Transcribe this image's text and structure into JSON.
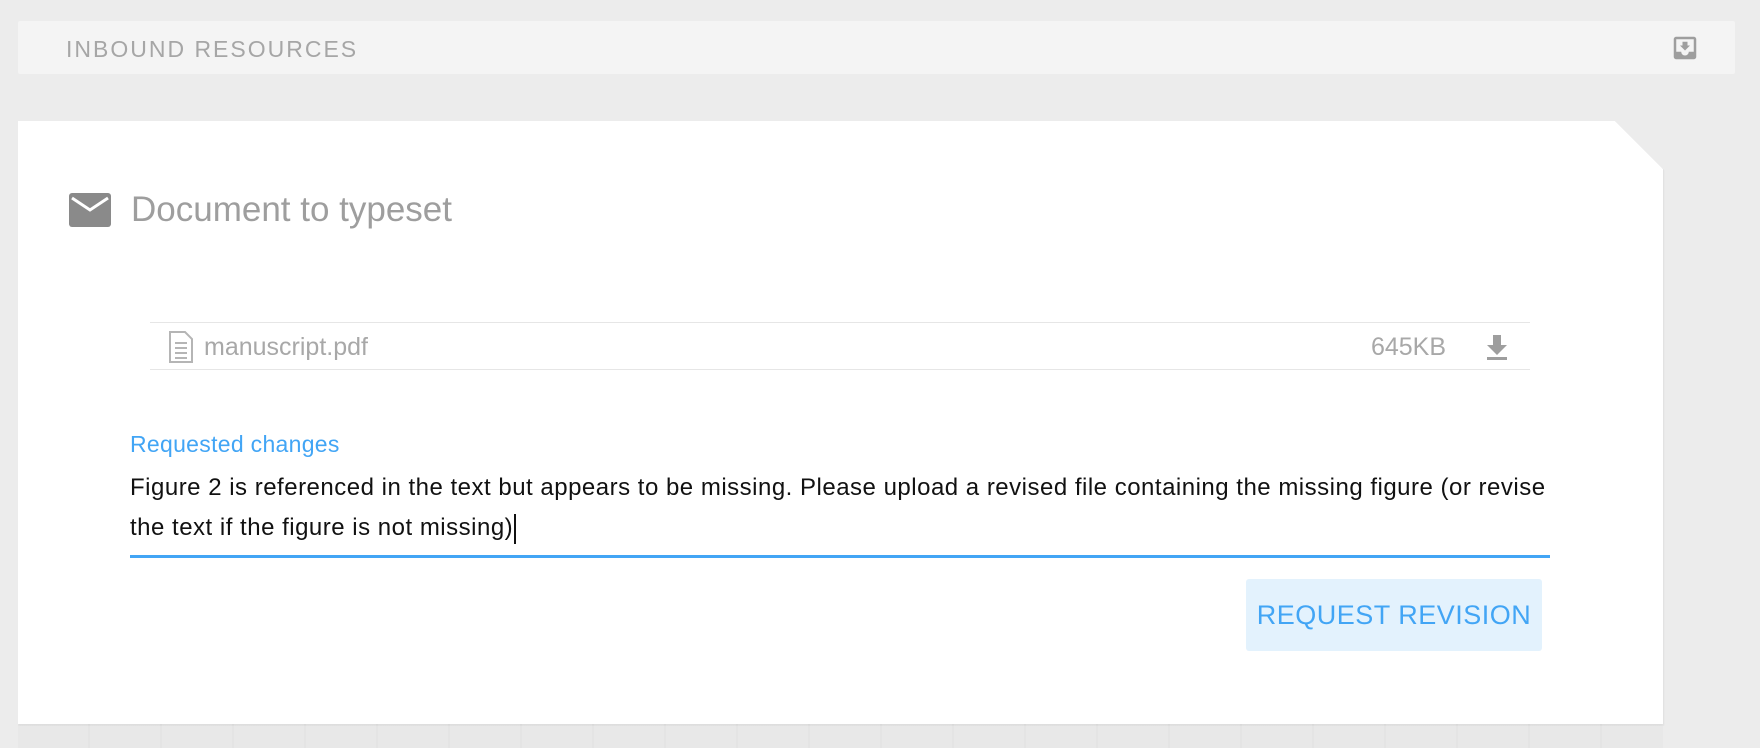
{
  "inbound": {
    "title": "INBOUND RESOURCES",
    "icon": "download-tray-icon"
  },
  "card": {
    "icon": "mail-icon",
    "title": "Document to typeset",
    "file": {
      "name": "manuscript.pdf",
      "size": "645KB",
      "file_icon": "document-icon",
      "download_icon": "download-icon"
    },
    "requested_changes": {
      "label": "Requested changes",
      "value": "Figure 2 is referenced in the text but appears to be missing. Please upload a revised file containing the missing figure (or revise the text if the figure is not missing)"
    },
    "request_revision_label": "REQUEST REVISION"
  },
  "colors": {
    "accent": "#42a5f5",
    "button_bg": "#e3f2fd",
    "muted_text": "#a8a8a8",
    "background": "#ececec"
  }
}
